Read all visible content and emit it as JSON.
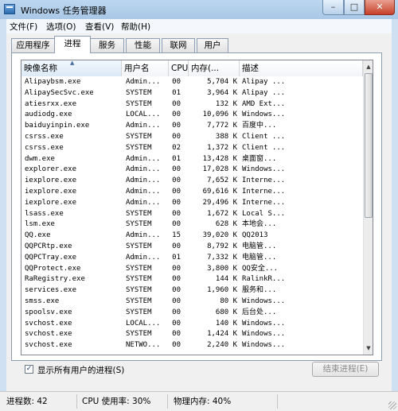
{
  "window": {
    "title": "Windows 任务管理器",
    "min_glyph": "–",
    "max_glyph": "□",
    "close_glyph": "✕"
  },
  "menu": {
    "items": [
      "文件(F)",
      "选项(O)",
      "查看(V)",
      "帮助(H)"
    ]
  },
  "tabs": [
    "应用程序",
    "进程",
    "服务",
    "性能",
    "联网",
    "用户"
  ],
  "active_tab": "进程",
  "columns": [
    "映像名称",
    "用户名",
    "CPU",
    "内存(...",
    "描述"
  ],
  "sort_indicator": "▲",
  "processes": [
    [
      "Alipaybsm.exe",
      "Admin...",
      "00",
      "5,704 K",
      "Alipay ..."
    ],
    [
      "AlipaySecSvc.exe",
      "SYSTEM",
      "01",
      "3,964 K",
      "Alipay ..."
    ],
    [
      "atiesrxx.exe",
      "SYSTEM",
      "00",
      "132 K",
      "AMD Ext..."
    ],
    [
      "audiodg.exe",
      "LOCAL...",
      "00",
      "10,096 K",
      "Windows..."
    ],
    [
      "baiduyinpin.exe",
      "Admin...",
      "00",
      "7,772 K",
      "百度中..."
    ],
    [
      "csrss.exe",
      "SYSTEM",
      "00",
      "388 K",
      "Client ..."
    ],
    [
      "csrss.exe",
      "SYSTEM",
      "02",
      "1,372 K",
      "Client ..."
    ],
    [
      "dwm.exe",
      "Admin...",
      "01",
      "13,428 K",
      "桌面窗..."
    ],
    [
      "explorer.exe",
      "Admin...",
      "00",
      "17,028 K",
      "Windows..."
    ],
    [
      "iexplore.exe",
      "Admin...",
      "00",
      "7,652 K",
      "Interne..."
    ],
    [
      "iexplore.exe",
      "Admin...",
      "00",
      "69,616 K",
      "Interne..."
    ],
    [
      "iexplore.exe",
      "Admin...",
      "00",
      "29,496 K",
      "Interne..."
    ],
    [
      "lsass.exe",
      "SYSTEM",
      "00",
      "1,672 K",
      "Local S..."
    ],
    [
      "lsm.exe",
      "SYSTEM",
      "00",
      "628 K",
      "本地会..."
    ],
    [
      "QQ.exe",
      "Admin...",
      "15",
      "39,020 K",
      "QQ2013"
    ],
    [
      "QQPCRtp.exe",
      "SYSTEM",
      "00",
      "8,792 K",
      "电脑管..."
    ],
    [
      "QQPCTray.exe",
      "Admin...",
      "01",
      "7,332 K",
      "电脑管..."
    ],
    [
      "QQProtect.exe",
      "SYSTEM",
      "00",
      "3,800 K",
      "QQ安全..."
    ],
    [
      "RaRegistry.exe",
      "SYSTEM",
      "00",
      "144 K",
      "RalinkR..."
    ],
    [
      "services.exe",
      "SYSTEM",
      "00",
      "1,960 K",
      "服务和..."
    ],
    [
      "smss.exe",
      "SYSTEM",
      "00",
      "80 K",
      "Windows..."
    ],
    [
      "spoolsv.exe",
      "SYSTEM",
      "00",
      "680 K",
      "后台处..."
    ],
    [
      "svchost.exe",
      "LOCAL...",
      "00",
      "140 K",
      "Windows..."
    ],
    [
      "svchost.exe",
      "SYSTEM",
      "00",
      "1,424 K",
      "Windows..."
    ],
    [
      "svchost.exe",
      "NETWO...",
      "00",
      "2,240 K",
      "Windows..."
    ]
  ],
  "show_all_users": {
    "label": "显示所有用户的进程(S)",
    "checked": true,
    "check_glyph": "✓"
  },
  "end_process_button": "结束进程(E)",
  "status": {
    "processes": "进程数: 42",
    "cpu": "CPU 使用率: 30%",
    "memory": "物理内存: 40%"
  },
  "scrollbar": {
    "up": "▲",
    "down": "▼"
  }
}
